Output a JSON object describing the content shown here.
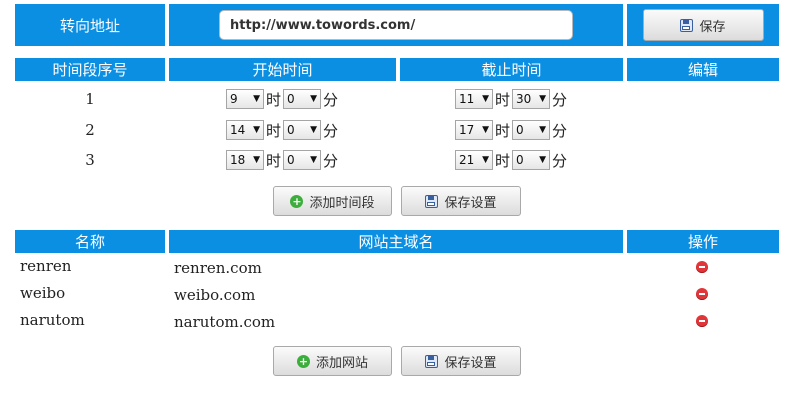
{
  "redirect": {
    "label": "转向地址",
    "url_value": "http://www.towords.com/",
    "save_label": "保存"
  },
  "schedule": {
    "headers": [
      "时间段序号",
      "开始时间",
      "截止时间",
      "编辑"
    ],
    "hour_unit": "时",
    "minute_unit": "分",
    "rows": [
      {
        "index": "1",
        "start_hour": "9",
        "start_min": "0",
        "end_hour": "11",
        "end_min": "30"
      },
      {
        "index": "2",
        "start_hour": "14",
        "start_min": "0",
        "end_hour": "17",
        "end_min": "0"
      },
      {
        "index": "3",
        "start_hour": "18",
        "start_min": "0",
        "end_hour": "21",
        "end_min": "0"
      }
    ],
    "add_label": "添加时间段",
    "save_label": "保存设置"
  },
  "sites": {
    "headers": [
      "名称",
      "网站主域名",
      "操作"
    ],
    "rows": [
      {
        "name": "renren",
        "domain": "renren.com"
      },
      {
        "name": "weibo",
        "domain": "weibo.com"
      },
      {
        "name": "narutom",
        "domain": "narutom.com"
      }
    ],
    "add_label": "添加网站",
    "save_label": "保存设置"
  },
  "colors": {
    "header_blue": "#0b8fe3",
    "add_green": "#3cae3c",
    "remove_red": "#e0363a"
  }
}
